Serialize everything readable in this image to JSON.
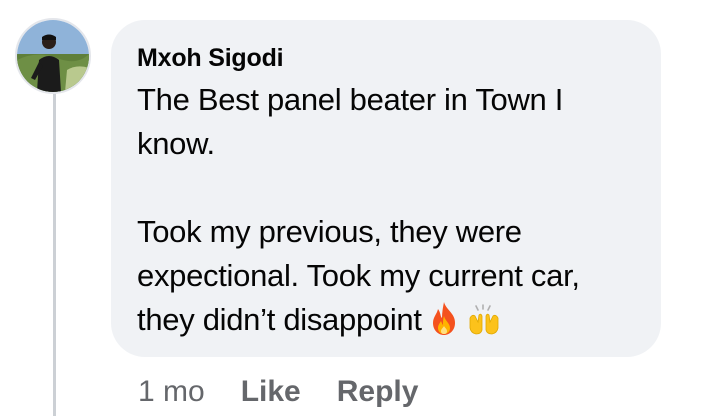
{
  "comment": {
    "author": "Mxoh Sigodi",
    "text_paragraph_1": "The Best panel beater in Town I know.",
    "text_paragraph_2": "Took my previous, they were expectional. Took my current car, they didn’t disappoint",
    "emojis": [
      "fire-emoji",
      "raising-hands-emoji"
    ]
  },
  "actions": {
    "time": "1 mo",
    "like_label": "Like",
    "reply_label": "Reply"
  },
  "colors": {
    "bubble_bg": "#f0f2f5",
    "text": "#050505",
    "muted": "#65676b",
    "thread_line": "#ccd0d5"
  }
}
